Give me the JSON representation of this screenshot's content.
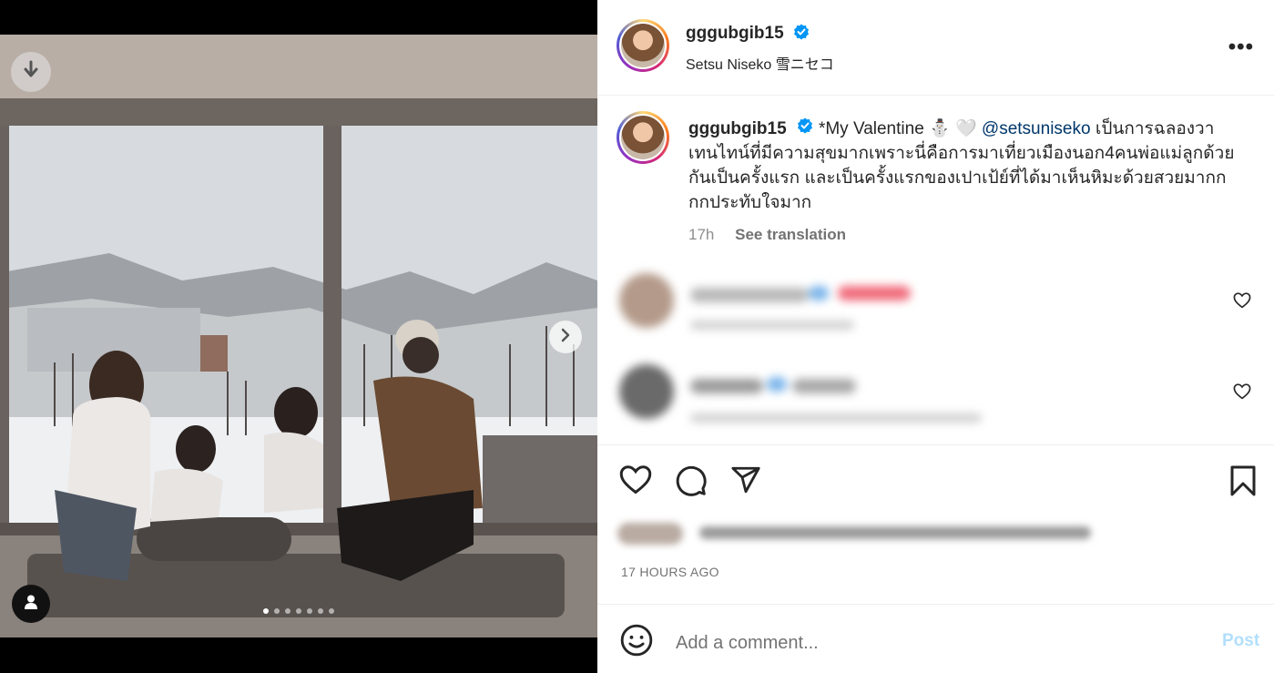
{
  "post": {
    "username": "gggubgib15",
    "location": "Setsu Niseko 雪ニセコ",
    "caption_user": "gggubgib15",
    "caption_prefix": "*My Valentine ",
    "caption_emoji": "⛄️ 🤍",
    "caption_mention": "@setsuniseko",
    "caption_body": " เป็นการฉลองวาเทนไทน์ที่มีความสุขมากเพราะนี่คือการมาเที่ยวเมืองนอก4คนพ่อแม่ลูกด้วยกันเป็นครั้งแรก และเป็นครั้งแรกของเปาเป้ย์ที่ได้มาเห็นหิมะด้วยสวยมากกกกประทับใจมาก",
    "caption_age": "17h",
    "see_translation": "See translation",
    "timestamp": "17 HOURS AGO"
  },
  "carousel": {
    "total": 7,
    "active": 0
  },
  "comment_box": {
    "placeholder": "Add a comment...",
    "post_label": "Post"
  },
  "icons": {
    "download": "download-arrow-icon",
    "next": "chevron-right-icon",
    "tagged": "user-tag-icon",
    "more": "more-options-icon",
    "like": "heart-icon",
    "comment": "comment-bubble-icon",
    "share": "paper-plane-icon",
    "save": "bookmark-icon",
    "emoji": "emoji-smiley-icon",
    "verified": "verified-badge-icon"
  },
  "colors": {
    "link": "#00376b",
    "verified": "#0095f6",
    "post_disabled": "#b2dffc"
  }
}
